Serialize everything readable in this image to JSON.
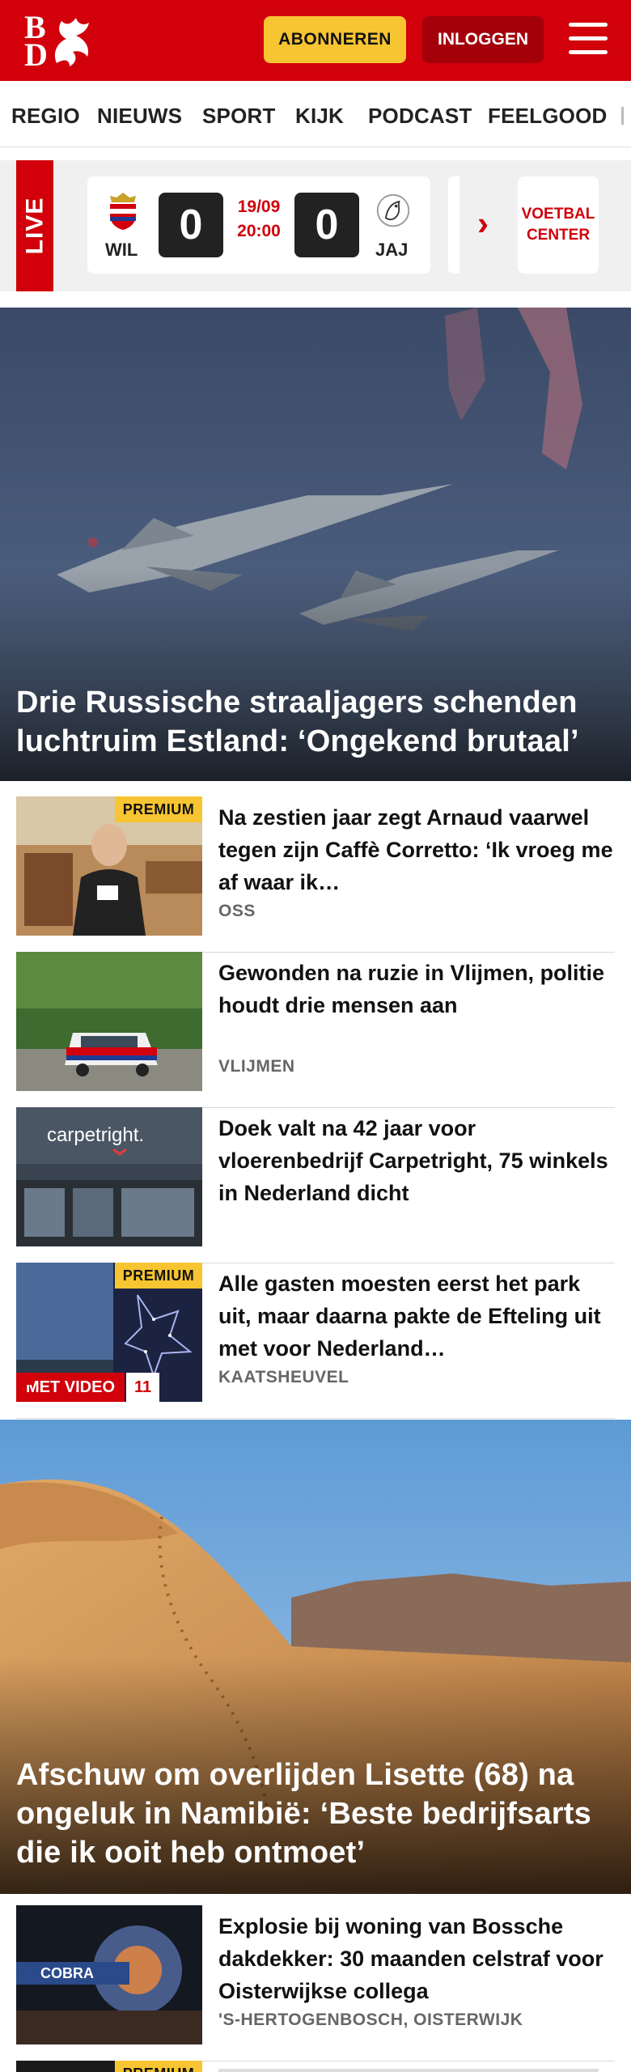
{
  "header": {
    "logo_top": "B",
    "logo_bottom": "D",
    "subscribe_label": "ABONNEREN",
    "login_label": "INLOGGEN",
    "brand_color": "#d1000b",
    "accent_color": "#f7c531"
  },
  "nav": {
    "items": [
      "REGIO",
      "NIEUWS",
      "SPORT",
      "KIJK",
      "PODCAST",
      "FEELGOOD"
    ]
  },
  "live": {
    "label": "LIVE",
    "match": {
      "home_code": "WIL",
      "away_code": "JAJ",
      "home_score": "0",
      "away_score": "0",
      "date": "19/09",
      "time": "20:00"
    },
    "center_line1": "VOETBAL",
    "center_line2": "CENTER"
  },
  "hero1": {
    "title": "Drie Russische straaljagers schenden luchtruim Estland: ‘Ongekend brutaal’"
  },
  "articles": [
    {
      "title": "Na zestien jaar zegt Arnaud vaarwel tegen zijn Caffè Corretto: ‘Ik vroeg me af waar ik…",
      "location": "OSS",
      "badge": "PREMIUM"
    },
    {
      "title": "Gewonden na ruzie in Vlijmen, politie houdt drie mensen aan",
      "location": "VLIJMEN"
    },
    {
      "title": "Doek valt na 42 jaar voor vloerenbedrijf Carpetright, 75 winkels in Nederland dicht",
      "location": "",
      "thumb_text": "carpetright."
    },
    {
      "title": "Alle gasten moesten eerst het park uit, maar daarna pakte de Efteling uit met voor Nederland…",
      "location": "KAATSHEUVEL",
      "badge": "PREMIUM",
      "video_label": "MET VIDEO",
      "comment_count": "11"
    }
  ],
  "hero2": {
    "title": "Afschuw om overlijden Lisette (68) na ongeluk in Namibië: ‘Beste bedrijfs­arts die ik ooit heb ontmoet’"
  },
  "articles2": [
    {
      "title": "Explosie bij woning van Bossche dakdekker: 30 maanden celstraf voor Oisterwijkse collega",
      "location": "'S-HERTOGENBOSCH, OISTERWIJK",
      "thumb_text": "COBRA"
    },
    {
      "badge": "PREMIUM"
    }
  ]
}
